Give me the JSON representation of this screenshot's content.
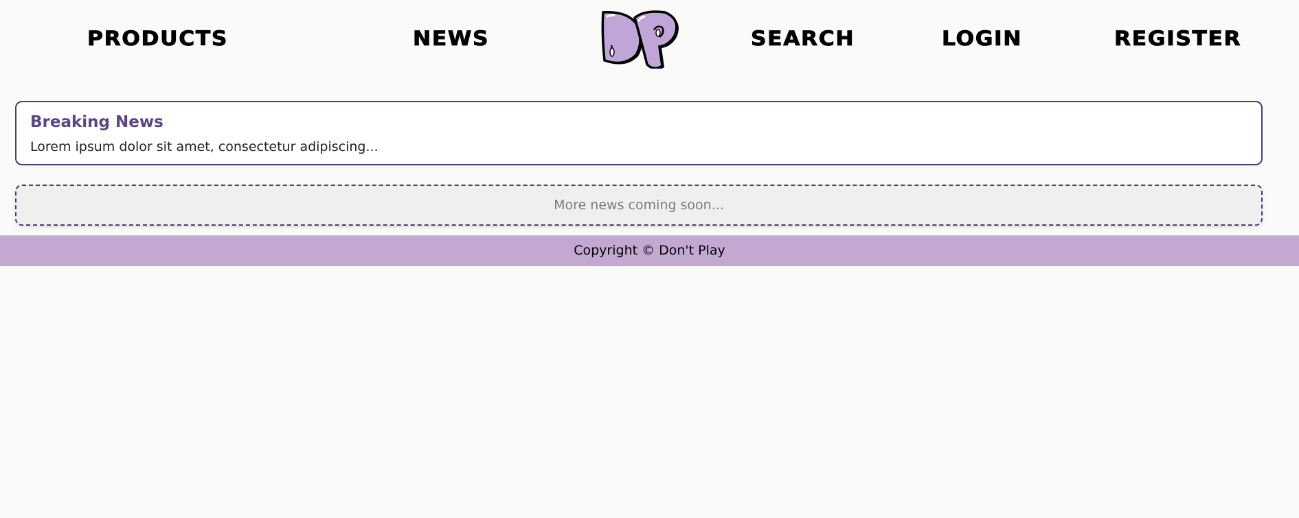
{
  "nav": {
    "products_label": "PRODUCTS",
    "news_label": "NEWS",
    "search_label": "SEARCH",
    "login_label": "LOGIN",
    "register_label": "REGISTER",
    "logo_text": "DP",
    "logo_icon": "dp-logo-icon"
  },
  "news_card": {
    "title": "Breaking News",
    "body": "Lorem ipsum dolor sit amet, consectetur adipiscing..."
  },
  "coming_soon": {
    "text": "More news coming soon..."
  },
  "footer": {
    "copyright": "Copyright © Don't Play"
  },
  "colors": {
    "background": "#fafaf8",
    "accent_purple": "#c3a9d1",
    "border_purple": "#4a3a78",
    "title_purple": "#5b4684",
    "logo_fill": "#c0a6d8"
  }
}
